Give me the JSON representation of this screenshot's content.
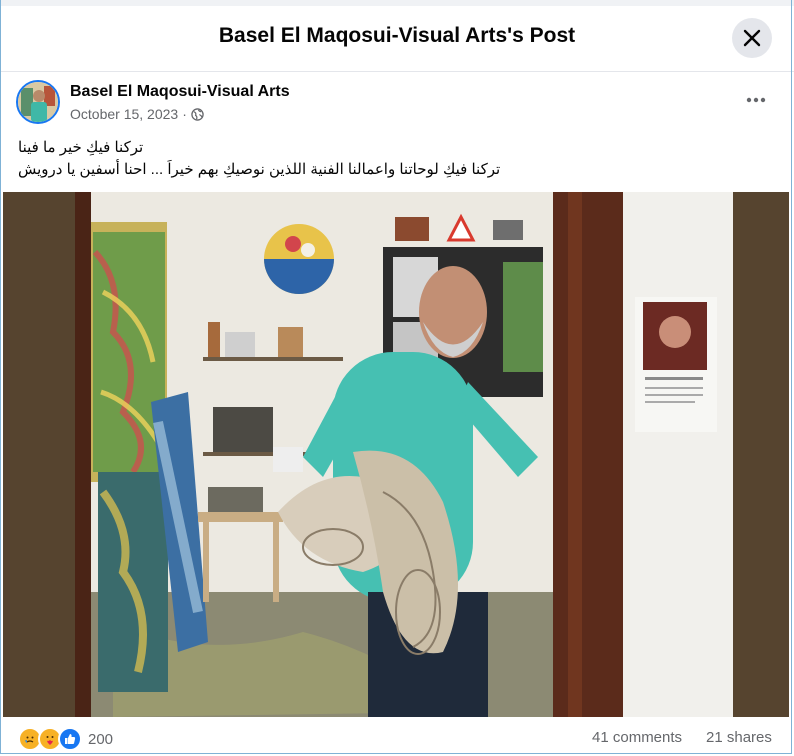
{
  "header": {
    "title": "Basel El Maqosui-Visual Arts's Post"
  },
  "post": {
    "author": "Basel El Maqosui-Visual Arts",
    "date": "October 15, 2023",
    "audience_icon": "globe-icon",
    "caption_line1": "تركنا فيكِ خير ما فينا",
    "caption_line2": "تركنا فيكِ لوحاتنا واعمالنا الفنية اللذين نوصيكِ بهم خيراَ ... احنا أسفين يا درويش"
  },
  "stats": {
    "reaction_icons": [
      "sad-icon",
      "care-icon",
      "like-icon"
    ],
    "reaction_count": "200",
    "comments": "41 comments",
    "shares": "21 shares"
  },
  "colors": {
    "accent": "#1877f2",
    "photo_frame": "#56442f",
    "muted": "#65676b"
  }
}
